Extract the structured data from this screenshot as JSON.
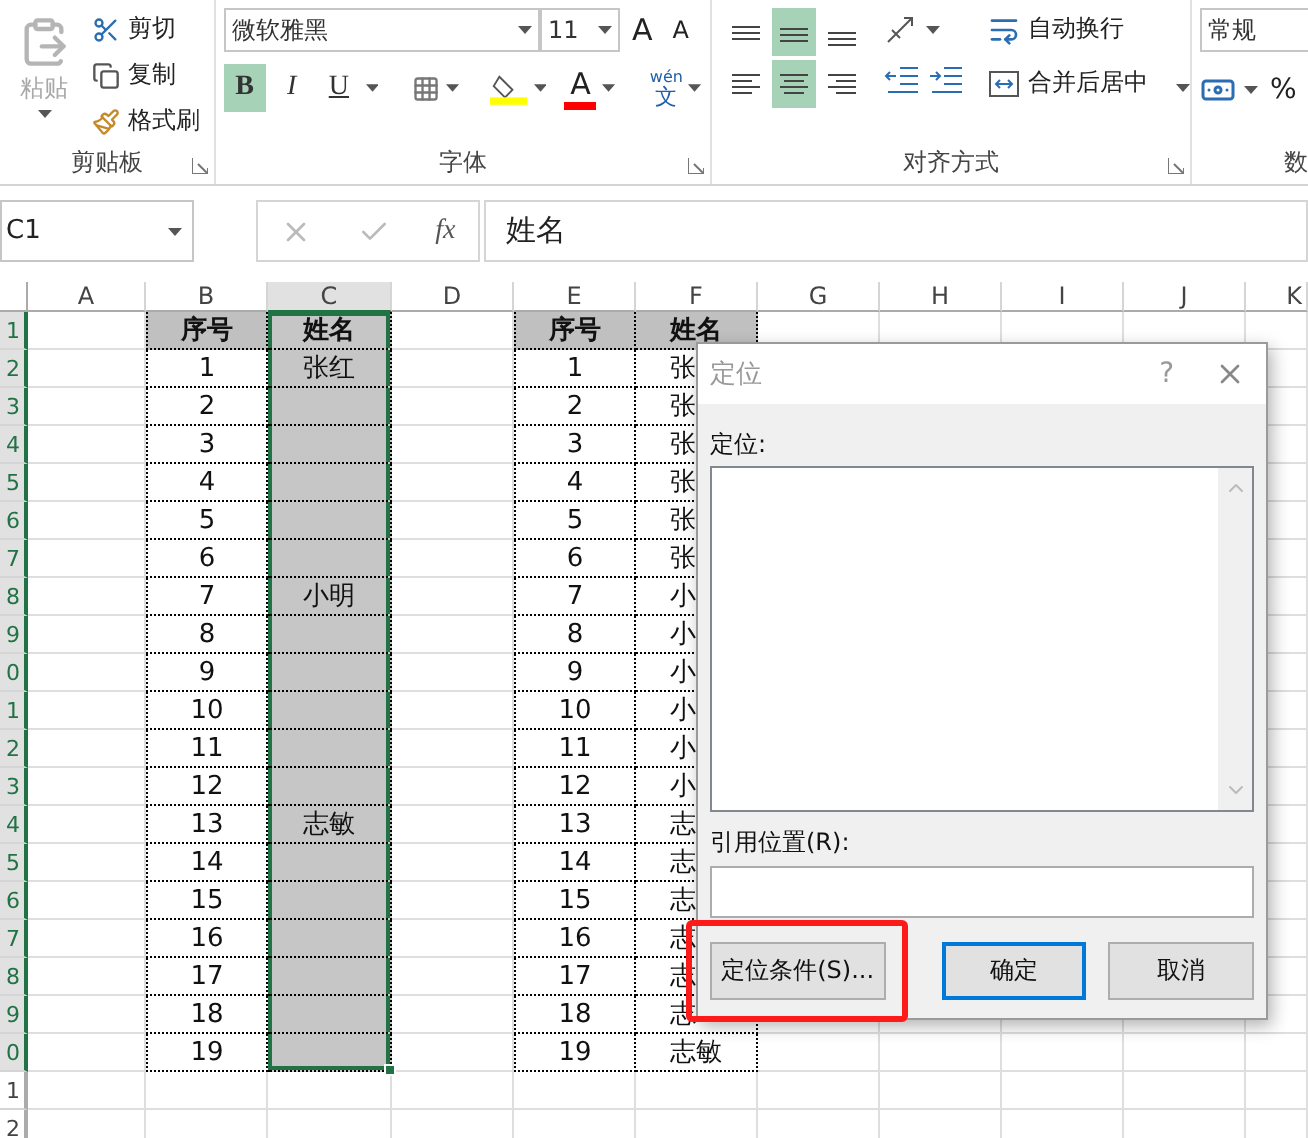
{
  "ribbon": {
    "clipboard": {
      "paste": {
        "label": "粘贴",
        "disabled": true
      },
      "actions": [
        {
          "kind": "cut",
          "label": "剪切"
        },
        {
          "kind": "copy",
          "label": "复制"
        },
        {
          "kind": "painter",
          "label": "格式刷"
        }
      ],
      "title": "剪贴板"
    },
    "font": {
      "font_name": "微软雅黑",
      "font_size": "11",
      "grow": "A",
      "shrink": "A",
      "styles": [
        {
          "kind": "bold",
          "label": "B",
          "selected": true
        },
        {
          "kind": "italic",
          "label": "I",
          "selected": false
        },
        {
          "kind": "underline",
          "label": "U",
          "selected": false
        }
      ],
      "font_color": "A",
      "phonetic_top": "wén",
      "phonetic_bottom": "文",
      "title": "字体"
    },
    "alignment": {
      "vertical": [
        {
          "kind": "top",
          "selected": false
        },
        {
          "kind": "middle",
          "selected": true
        },
        {
          "kind": "bottom",
          "selected": false
        }
      ],
      "horizontal": [
        {
          "kind": "left",
          "selected": false
        },
        {
          "kind": "center",
          "selected": true
        },
        {
          "kind": "right",
          "selected": false
        }
      ],
      "wrap_text": "自动换行",
      "merge": "合并后居中",
      "title": "对齐方式"
    },
    "number": {
      "format": "常规",
      "percent": "%",
      "title": "数"
    }
  },
  "formula_bar": {
    "name_box": "C1",
    "fx": "fx",
    "content": "姓名"
  },
  "sheet": {
    "columns": [
      {
        "label": "A",
        "selected": false
      },
      {
        "label": "B",
        "selected": false
      },
      {
        "label": "C",
        "selected": true
      },
      {
        "label": "D",
        "selected": false
      },
      {
        "label": "E",
        "selected": false
      },
      {
        "label": "F",
        "selected": false
      },
      {
        "label": "G",
        "selected": false
      },
      {
        "label": "H",
        "selected": false
      },
      {
        "label": "I",
        "selected": false
      },
      {
        "label": "J",
        "selected": false
      },
      {
        "label": "K",
        "selected": false
      }
    ],
    "rows": [
      {
        "label": "1",
        "selected": true
      },
      {
        "label": "2",
        "selected": true
      },
      {
        "label": "3",
        "selected": true
      },
      {
        "label": "4",
        "selected": true
      },
      {
        "label": "5",
        "selected": true
      },
      {
        "label": "6",
        "selected": true
      },
      {
        "label": "7",
        "selected": true
      },
      {
        "label": "8",
        "selected": true
      },
      {
        "label": "9",
        "selected": true
      },
      {
        "label": "0",
        "selected": true
      },
      {
        "label": "1",
        "selected": true
      },
      {
        "label": "2",
        "selected": true
      },
      {
        "label": "3",
        "selected": true
      },
      {
        "label": "4",
        "selected": true
      },
      {
        "label": "5",
        "selected": true
      },
      {
        "label": "6",
        "selected": true
      },
      {
        "label": "7",
        "selected": true
      },
      {
        "label": "8",
        "selected": true
      },
      {
        "label": "9",
        "selected": true
      },
      {
        "label": "0",
        "selected": true
      },
      {
        "label": "1",
        "selected": false
      },
      {
        "label": "2",
        "selected": false
      }
    ],
    "table_1": {
      "columns": [
        {
          "header": "序号",
          "selected": false
        },
        {
          "header": "姓名",
          "selected": true
        }
      ],
      "rows": [
        [
          "1",
          "张红"
        ],
        [
          "2"
        ],
        [
          "3"
        ],
        [
          "4"
        ],
        [
          "5"
        ],
        [
          "6"
        ],
        [
          "7",
          "小明"
        ],
        [
          "8"
        ],
        [
          "9"
        ],
        [
          "10"
        ],
        [
          "11"
        ],
        [
          "12"
        ],
        [
          "13",
          "志敏"
        ],
        [
          "14"
        ],
        [
          "15"
        ],
        [
          "16"
        ],
        [
          "17"
        ],
        [
          "18"
        ],
        [
          "19"
        ]
      ]
    },
    "table_2": {
      "columns": [
        {
          "header": "序号",
          "selected": false
        },
        {
          "header": "姓名",
          "selected": false
        }
      ],
      "rows": [
        [
          "1",
          "张"
        ],
        [
          "2",
          "张"
        ],
        [
          "3",
          "张"
        ],
        [
          "4",
          "张"
        ],
        [
          "5",
          "张"
        ],
        [
          "6",
          "张"
        ],
        [
          "7",
          "小"
        ],
        [
          "8",
          "小"
        ],
        [
          "9",
          "小"
        ],
        [
          "10",
          "小"
        ],
        [
          "11",
          "小"
        ],
        [
          "12",
          "小"
        ],
        [
          "13",
          "志"
        ],
        [
          "14",
          "志"
        ],
        [
          "15",
          "志"
        ],
        [
          "16",
          "志"
        ],
        [
          "17",
          "志"
        ],
        [
          "18",
          "志"
        ],
        [
          "19",
          "志敏"
        ]
      ]
    }
  },
  "dialog": {
    "title": "定位",
    "help": "?",
    "list_label": "定位:",
    "reference_label": "引用位置(R):",
    "buttons": [
      {
        "kind": "special",
        "label": "定位条件(S)...",
        "highlighted": true,
        "default": false
      },
      {
        "kind": "ok",
        "label": "确定",
        "highlighted": false,
        "default": true
      },
      {
        "kind": "cancel",
        "label": "取消",
        "highlighted": false,
        "default": false
      }
    ]
  }
}
